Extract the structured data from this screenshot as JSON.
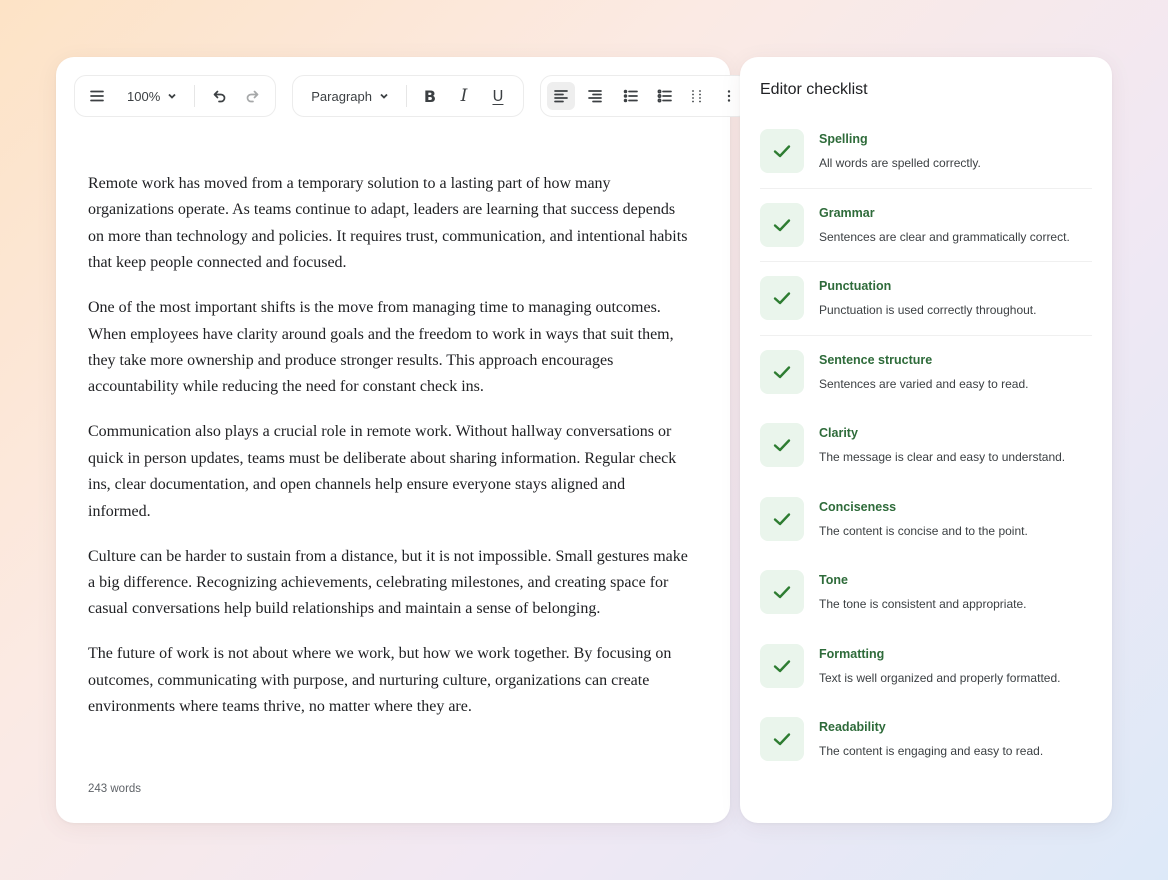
{
  "toolbar": {
    "zoom": "100%",
    "block_style": "Paragraph",
    "bold": "B",
    "italic": "I",
    "underline": "U"
  },
  "document": {
    "paragraphs": [
      "Remote work has moved from a temporary solution to a lasting part of how many organizations operate. As teams continue to adapt, leaders are learning that success depends on more than technology and policies. It requires trust, communication, and intentional habits that keep people connected and focused.",
      "One of the most important shifts is the move from managing time to managing outcomes. When employees have clarity around goals and the freedom to work in ways that suit them, they take more ownership and produce stronger results. This approach encourages accountability while reducing the need for constant check ins.",
      "Communication also plays a crucial role in remote work. Without hallway conversations or quick in person updates, teams must be deliberate about sharing information. Regular check ins, clear documentation, and open channels help ensure everyone stays aligned and informed.",
      "Culture can be harder to sustain from a distance, but it is not impossible. Small gestures make a big difference. Recognizing achievements, celebrating milestones, and creating space for casual conversations help build relationships and maintain a sense of belonging.",
      "The future of work is not about where we work, but how we work together. By focusing on outcomes, communicating with purpose, and nurturing culture, organizations can create environments where teams thrive, no matter where they are."
    ],
    "word_count": "243 words"
  },
  "checklist": {
    "title": "Editor checklist",
    "accent_color": "#2e7d32",
    "items": [
      {
        "name": "Spelling",
        "desc": "All words are spelled correctly."
      },
      {
        "name": "Grammar",
        "desc": "Sentences are clear and grammatically correct."
      },
      {
        "name": "Punctuation",
        "desc": "Punctuation is used correctly throughout."
      },
      {
        "name": "Sentence structure",
        "desc": "Sentences are varied and easy to read."
      },
      {
        "name": "Clarity",
        "desc": "The message is clear and easy to understand."
      },
      {
        "name": "Conciseness",
        "desc": "The content is concise and to the point."
      },
      {
        "name": "Tone",
        "desc": "The tone is consistent and appropriate."
      },
      {
        "name": "Formatting",
        "desc": "Text is well organized and properly formatted."
      },
      {
        "name": "Readability",
        "desc": "The content is engaging and easy to read."
      }
    ]
  }
}
